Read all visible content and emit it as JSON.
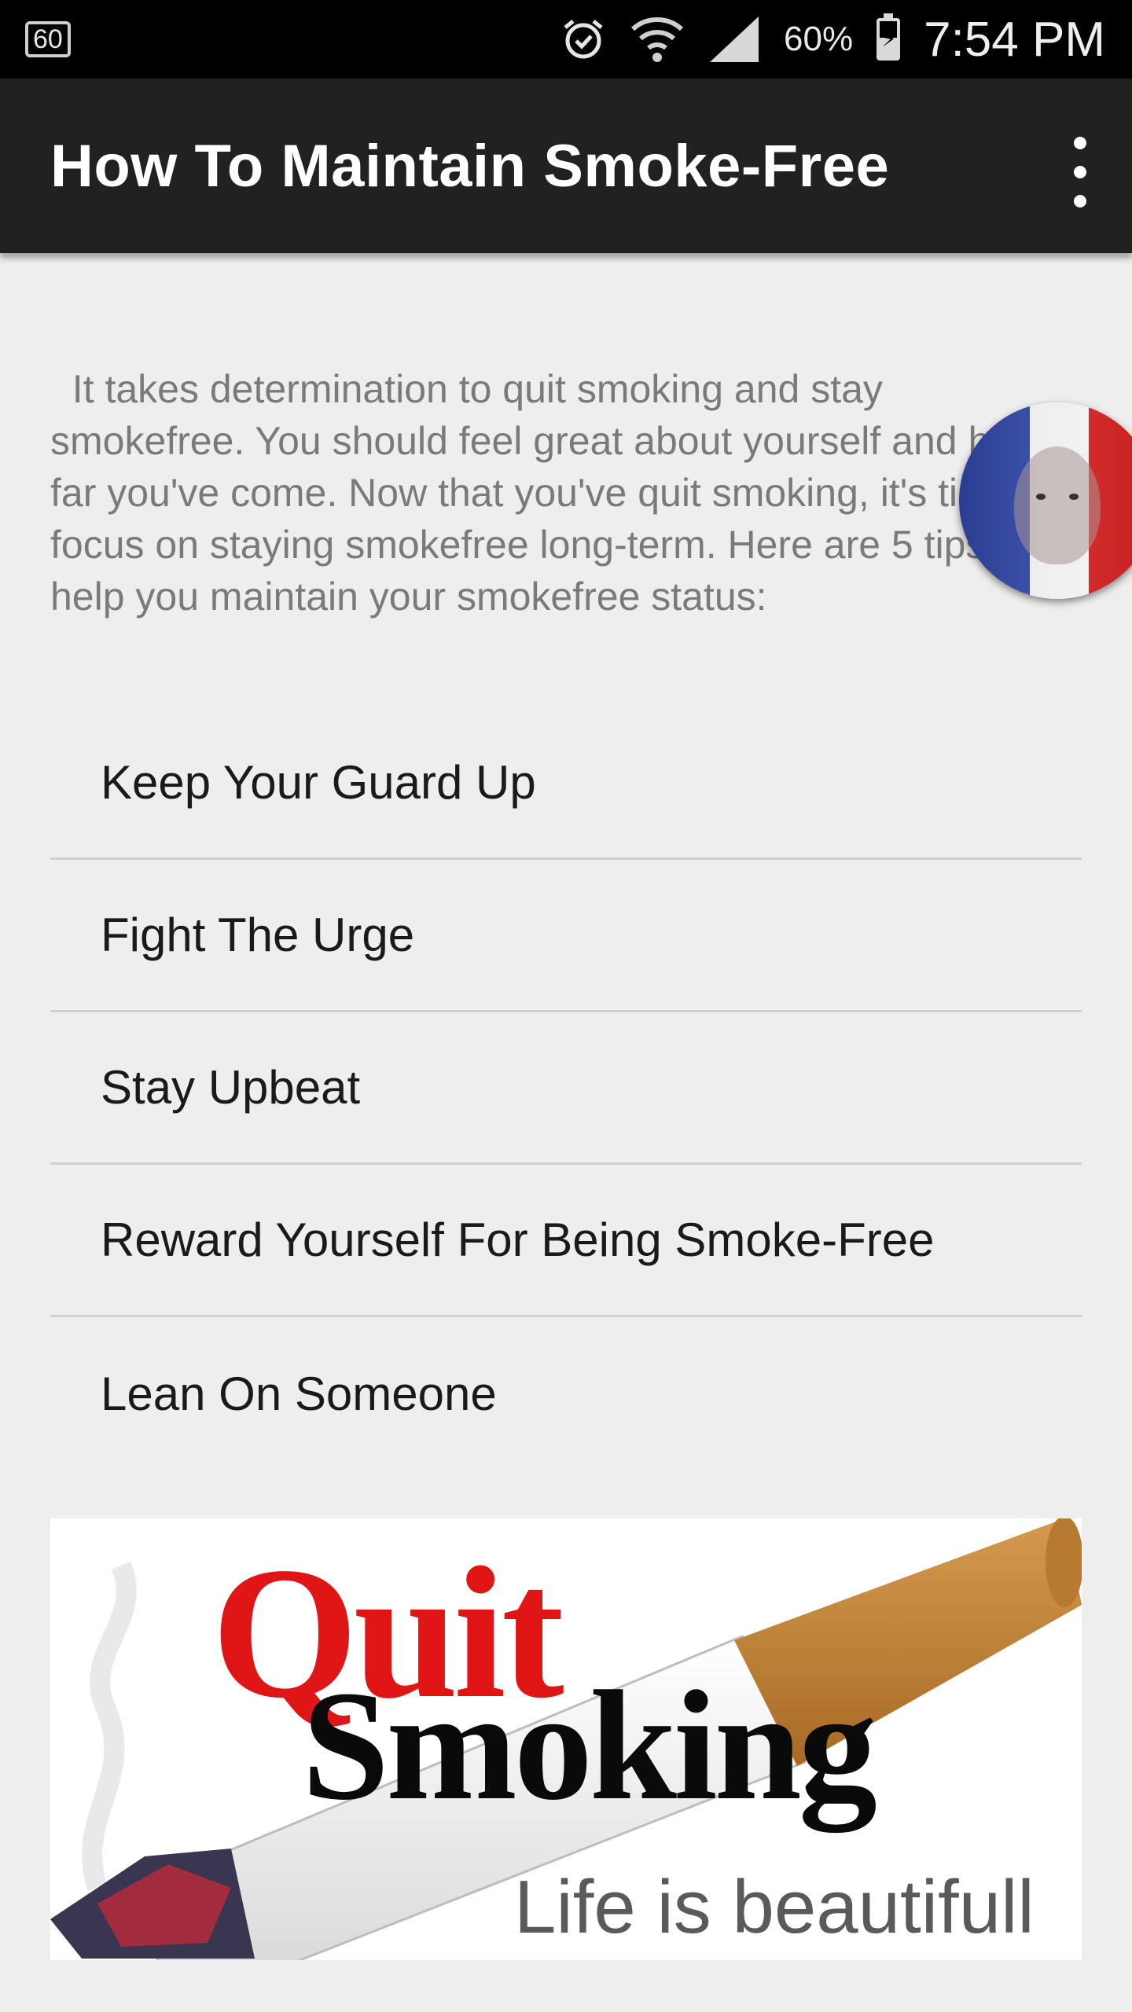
{
  "status_bar": {
    "badge": "60",
    "battery_text": "60%",
    "time": "7:54 PM",
    "icons": [
      "alarm-icon",
      "wifi-icon",
      "signal-icon",
      "battery-charging-icon"
    ]
  },
  "app_bar": {
    "title": "How To Maintain Smoke-Free",
    "menu_icon": "overflow-menu-icon"
  },
  "intro": "  It takes determination to quit smoking and stay smokefree. You should feel great about yourself and how far you've come. Now that you've quit smoking, it's time to focus on staying smokefree long-term. Here are 5 tips to help you maintain your smokefree status:",
  "tips": [
    {
      "label": "Keep Your Guard Up"
    },
    {
      "label": "Fight The Urge"
    },
    {
      "label": "Stay Upbeat"
    },
    {
      "label": "Reward Yourself For Being Smoke-Free"
    },
    {
      "label": "Lean On Someone"
    }
  ],
  "banner": {
    "line1": "Quit",
    "line2": "Smoking",
    "line3": "Life is beautifull"
  },
  "colors": {
    "appbar": "#212121",
    "background": "#eeeeee",
    "quit_red": "#e01616"
  }
}
